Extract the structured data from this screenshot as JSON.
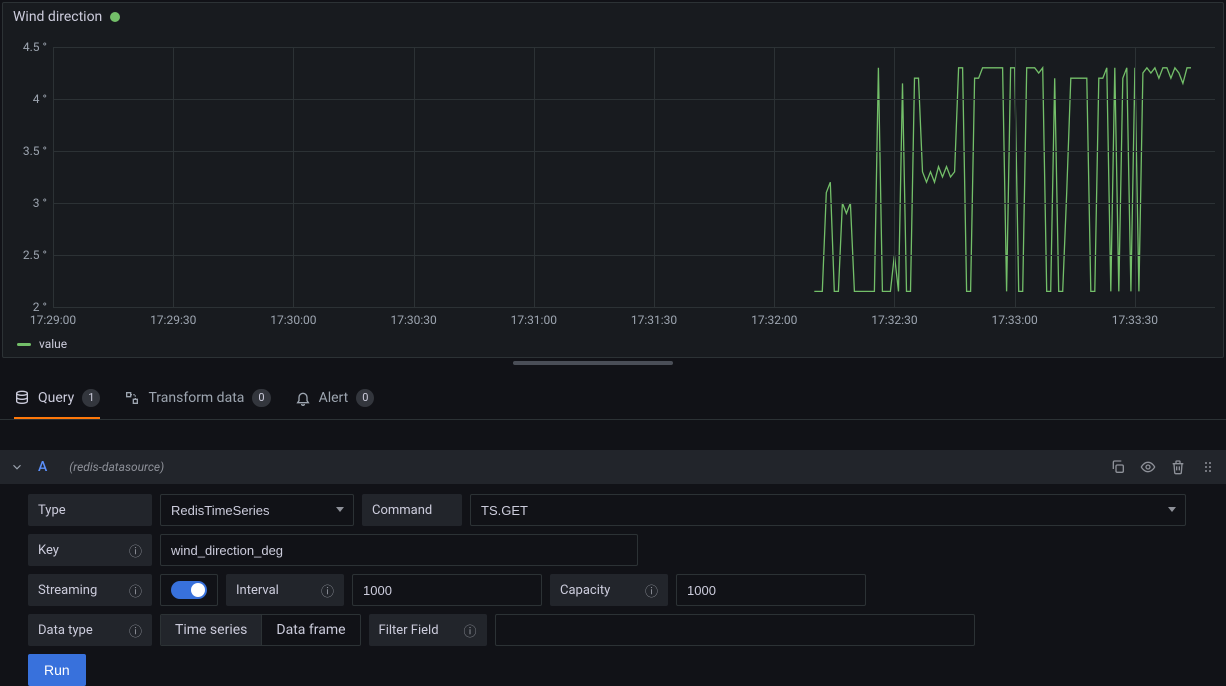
{
  "panel": {
    "title": "Wind direction",
    "status_color": "#73bf69"
  },
  "chart_data": {
    "type": "line",
    "title": "Wind direction",
    "xlabel": "",
    "ylabel": "",
    "ylim": [
      2,
      4.5
    ],
    "y_ticks": [
      "2 °",
      "2.5 °",
      "3 °",
      "3.5 °",
      "4 °",
      "4.5 °"
    ],
    "x_ticks": [
      "17:29:00",
      "17:29:30",
      "17:30:00",
      "17:30:30",
      "17:31:00",
      "17:31:30",
      "17:32:00",
      "17:32:30",
      "17:33:00",
      "17:33:30"
    ],
    "series": [
      {
        "name": "value",
        "color": "#73bf69",
        "x": [
          "17:32:10",
          "17:32:11",
          "17:32:12",
          "17:32:13",
          "17:32:14",
          "17:32:15",
          "17:32:16",
          "17:32:17",
          "17:32:18",
          "17:32:19",
          "17:32:20",
          "17:32:21",
          "17:32:22",
          "17:32:23",
          "17:32:24",
          "17:32:25",
          "17:32:26",
          "17:32:27",
          "17:32:28",
          "17:32:29",
          "17:32:30",
          "17:32:31",
          "17:32:32",
          "17:32:33",
          "17:32:34",
          "17:32:35",
          "17:32:36",
          "17:32:37",
          "17:32:38",
          "17:32:39",
          "17:32:40",
          "17:32:41",
          "17:32:42",
          "17:32:43",
          "17:32:44",
          "17:32:45",
          "17:32:46",
          "17:32:47",
          "17:32:48",
          "17:32:49",
          "17:32:50",
          "17:32:51",
          "17:32:52",
          "17:32:53",
          "17:32:54",
          "17:32:55",
          "17:32:56",
          "17:32:57",
          "17:32:58",
          "17:32:59",
          "17:33:00",
          "17:33:01",
          "17:33:02",
          "17:33:03",
          "17:33:04",
          "17:33:05",
          "17:33:06",
          "17:33:07",
          "17:33:08",
          "17:33:09",
          "17:33:10",
          "17:33:11",
          "17:33:12",
          "17:33:13",
          "17:33:14",
          "17:33:15",
          "17:33:16",
          "17:33:17",
          "17:33:18",
          "17:33:19",
          "17:33:20",
          "17:33:21",
          "17:33:22",
          "17:33:23",
          "17:33:24",
          "17:33:25",
          "17:33:26",
          "17:33:27",
          "17:33:28",
          "17:33:29",
          "17:33:30",
          "17:33:31",
          "17:33:32",
          "17:33:33",
          "17:33:34",
          "17:33:35",
          "17:33:36",
          "17:33:37",
          "17:33:38",
          "17:33:39",
          "17:33:40",
          "17:33:41",
          "17:33:42",
          "17:33:43",
          "17:33:44"
        ],
        "values": [
          2.15,
          2.15,
          2.15,
          3.1,
          3.2,
          2.15,
          2.15,
          3.0,
          2.9,
          3.0,
          2.15,
          2.15,
          2.15,
          2.15,
          2.15,
          2.15,
          4.3,
          2.15,
          2.15,
          2.15,
          2.5,
          2.15,
          4.15,
          2.15,
          2.15,
          4.2,
          4.2,
          3.3,
          3.2,
          3.3,
          3.2,
          3.35,
          3.25,
          3.35,
          3.25,
          3.3,
          4.3,
          4.3,
          2.15,
          2.15,
          4.2,
          4.2,
          4.3,
          4.3,
          4.3,
          4.3,
          4.3,
          4.3,
          2.15,
          4.3,
          4.3,
          2.15,
          2.15,
          4.3,
          4.3,
          4.3,
          4.25,
          4.3,
          2.15,
          2.15,
          4.2,
          2.15,
          2.15,
          3.1,
          4.2,
          4.2,
          4.2,
          4.2,
          4.2,
          2.15,
          2.15,
          4.2,
          4.2,
          4.3,
          2.15,
          4.3,
          2.15,
          4.2,
          4.3,
          2.15,
          4.3,
          2.15,
          4.25,
          4.3,
          4.25,
          4.3,
          4.2,
          4.3,
          4.3,
          4.2,
          4.3,
          4.25,
          4.15,
          4.3,
          4.3
        ]
      }
    ]
  },
  "legend": {
    "label": "value"
  },
  "tabs": {
    "query": {
      "label": "Query",
      "count": "1"
    },
    "transform": {
      "label": "Transform data",
      "count": "0"
    },
    "alert": {
      "label": "Alert",
      "count": "0"
    }
  },
  "query": {
    "letter": "A",
    "datasource": "(redis-datasource)",
    "fields": {
      "type_label": "Type",
      "type_value": "RedisTimeSeries",
      "command_label": "Command",
      "command_value": "TS.GET",
      "key_label": "Key",
      "key_value": "wind_direction_deg",
      "streaming_label": "Streaming",
      "interval_label": "Interval",
      "interval_value": "1000",
      "capacity_label": "Capacity",
      "capacity_value": "1000",
      "datatype_label": "Data type",
      "datatype_opts": {
        "ts": "Time series",
        "df": "Data frame"
      },
      "filter_label": "Filter Field",
      "run_label": "Run"
    }
  }
}
